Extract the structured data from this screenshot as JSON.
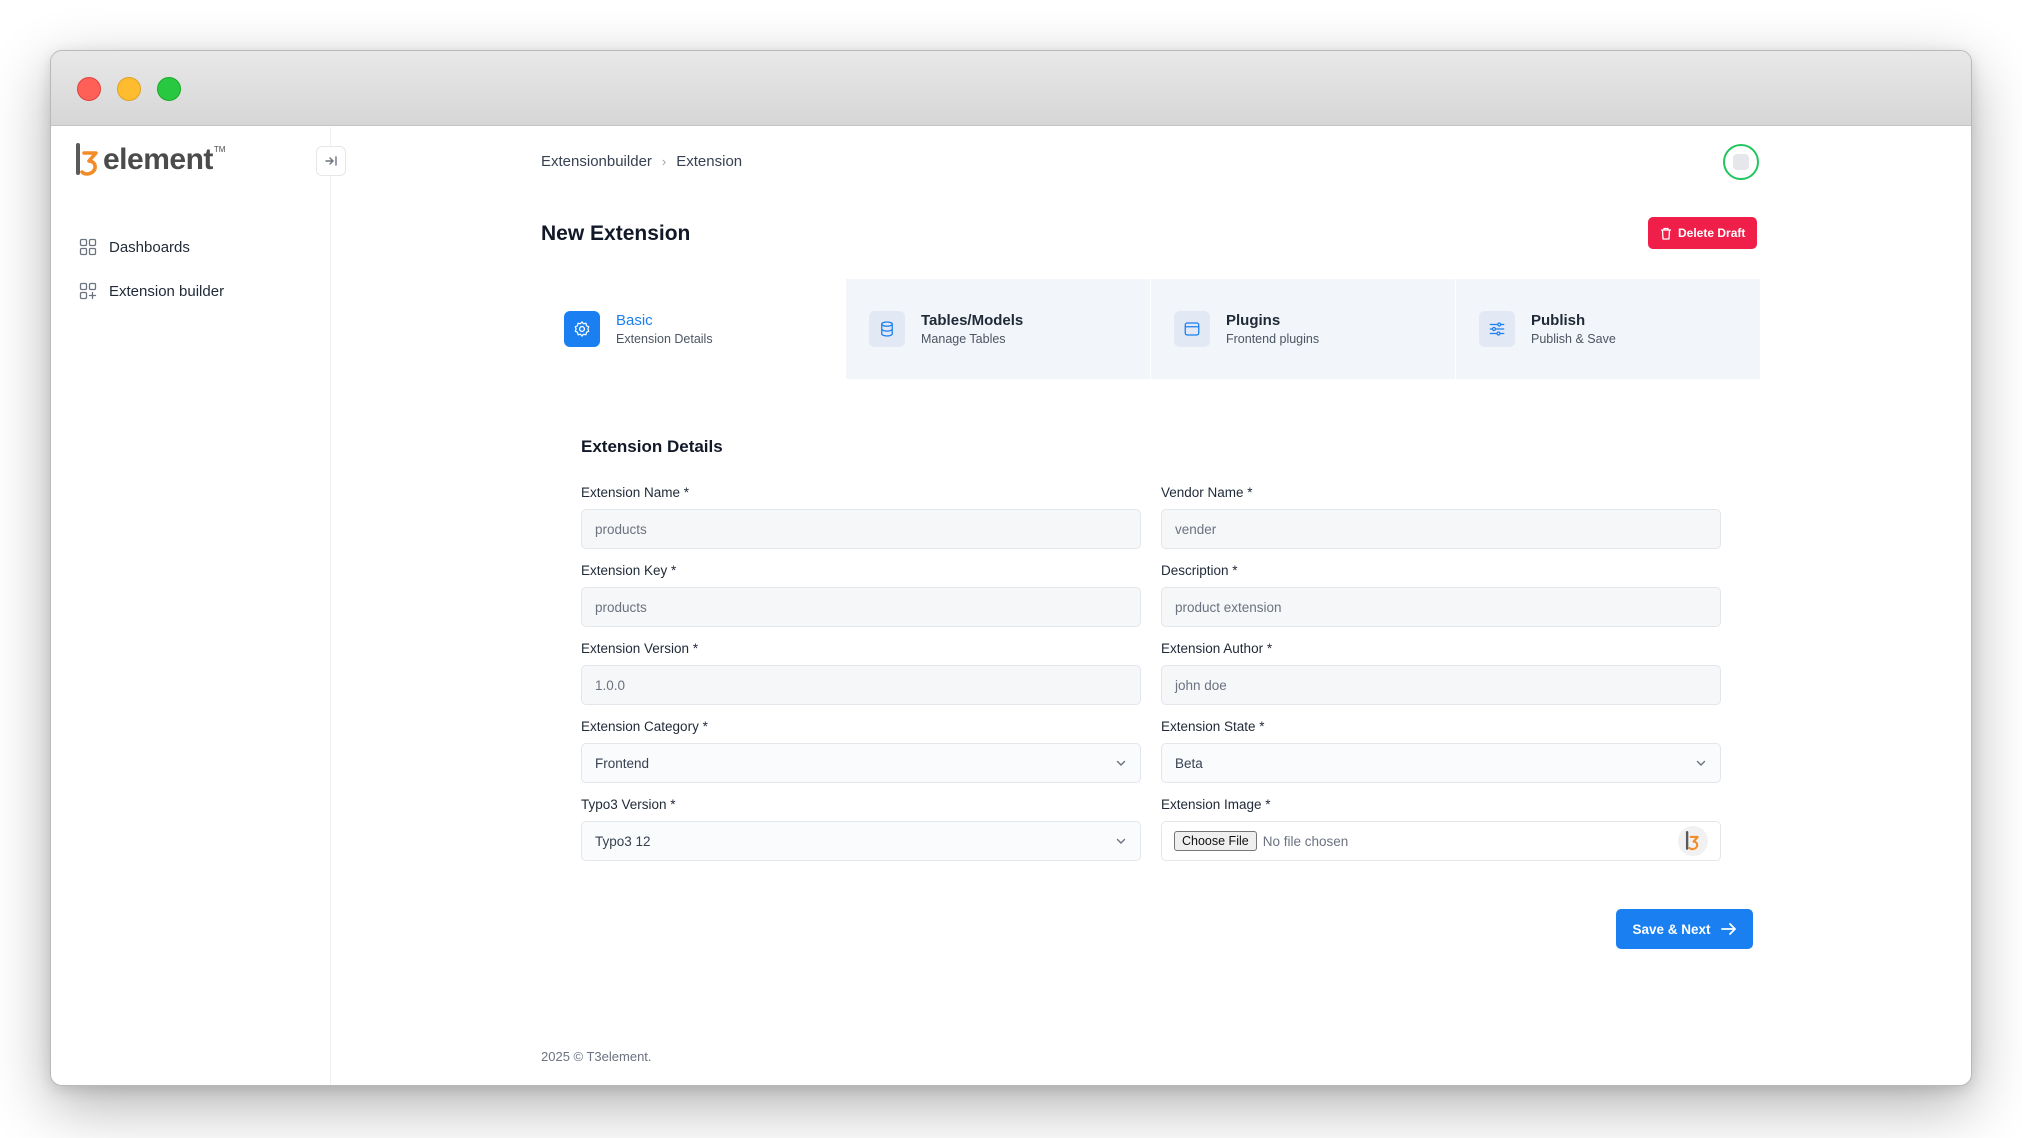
{
  "window": {
    "controls": [
      "close",
      "minimize",
      "maximize"
    ]
  },
  "brand": {
    "logo_text": "element",
    "trademark": "TM"
  },
  "sidebar": {
    "items": [
      {
        "label": "Dashboards",
        "icon": "grid-icon"
      },
      {
        "label": "Extension builder",
        "icon": "grid-add-icon"
      }
    ]
  },
  "breadcrumb": {
    "items": [
      "Extensionbuilder",
      "Extension"
    ],
    "separator": "›"
  },
  "page": {
    "title": "New Extension",
    "delete_label": "Delete Draft"
  },
  "tabs": [
    {
      "title": "Basic",
      "subtitle": "Extension Details",
      "icon": "gear-icon",
      "active": true
    },
    {
      "title": "Tables/Models",
      "subtitle": "Manage Tables",
      "icon": "database-icon",
      "active": false
    },
    {
      "title": "Plugins",
      "subtitle": "Frontend plugins",
      "icon": "window-icon",
      "active": false
    },
    {
      "title": "Publish",
      "subtitle": "Publish & Save",
      "icon": "sliders-icon",
      "active": false
    }
  ],
  "form": {
    "section_title": "Extension Details",
    "extension_name": {
      "label": "Extension Name *",
      "placeholder": "products"
    },
    "vendor_name": {
      "label": "Vendor Name *",
      "placeholder": "vender"
    },
    "extension_key": {
      "label": "Extension Key *",
      "placeholder": "products"
    },
    "description": {
      "label": "Description *",
      "placeholder": "product extension"
    },
    "extension_version": {
      "label": "Extension Version *",
      "placeholder": "1.0.0"
    },
    "extension_author": {
      "label": "Extension Author *",
      "placeholder": "john doe"
    },
    "extension_category": {
      "label": "Extension Category *",
      "value": "Frontend"
    },
    "extension_state": {
      "label": "Extension State *",
      "value": "Beta"
    },
    "typo3_version": {
      "label": "Typo3 Version *",
      "value": "Typo3 12"
    },
    "extension_image": {
      "label": "Extension Image *",
      "button": "Choose File",
      "status": "No file chosen"
    },
    "save_label": "Save & Next"
  },
  "footer": {
    "text": "2025 ©  T3element."
  },
  "colors": {
    "primary": "#1a7ff0",
    "danger": "#ef1f4a",
    "logo_orange": "#f28c28",
    "avatar_ring": "#22c55e"
  }
}
